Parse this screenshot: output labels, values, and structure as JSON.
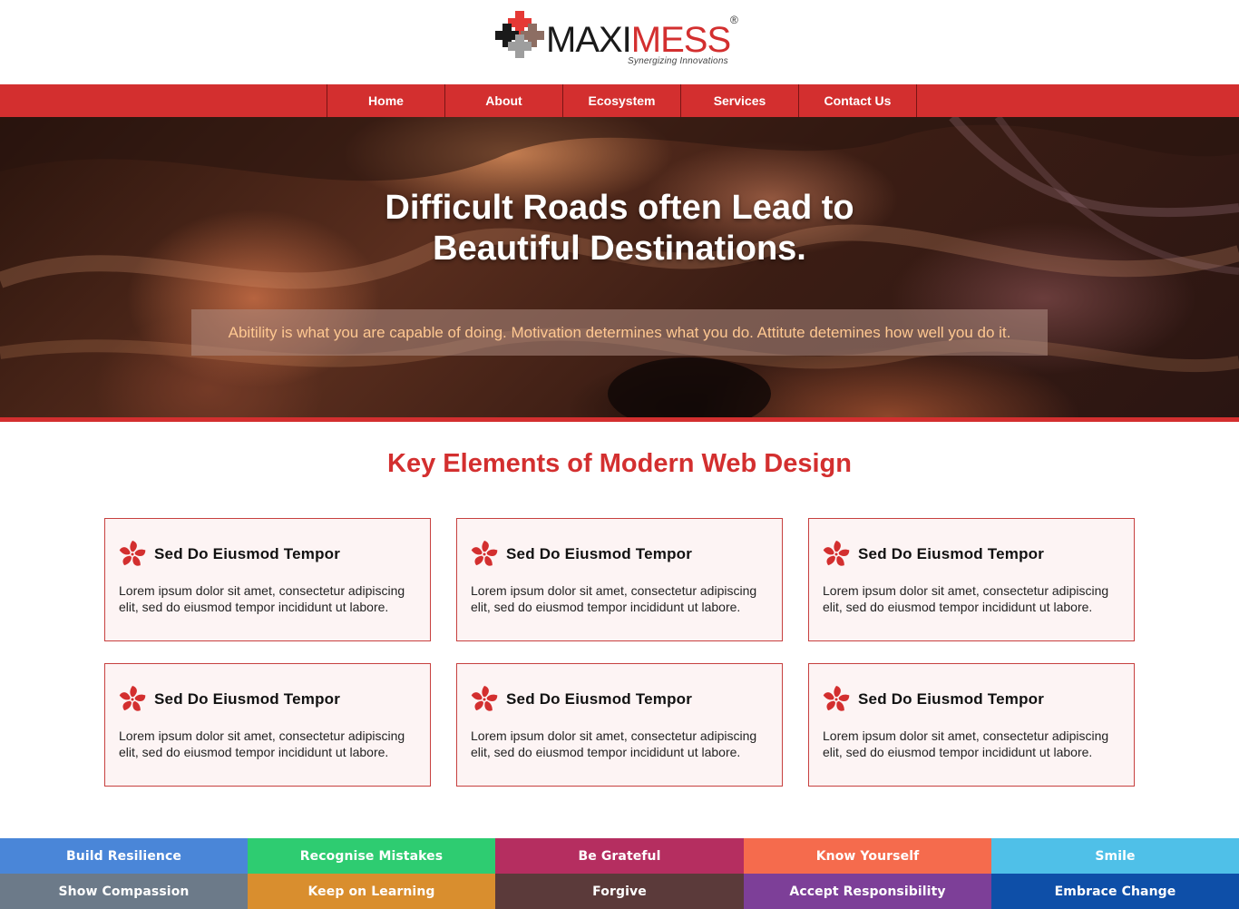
{
  "brand": {
    "name_part1": "MAXI",
    "name_part2": "MESS",
    "registered": "®",
    "tagline": "Synergizing Innovations"
  },
  "nav": {
    "items": [
      "Home",
      "About",
      "Ecosystem",
      "Services",
      "Contact Us"
    ]
  },
  "hero": {
    "title_line1": "Difficult Roads often Lead to",
    "title_line2": "Beautiful Destinations.",
    "quote": "Abitility is what you are capable of doing. Motivation determines what you do. Attitute detemines how well you do it."
  },
  "section": {
    "title": "Key Elements of Modern Web Design",
    "cards": [
      {
        "title": "Sed Do Eiusmod Tempor",
        "text": "Lorem ipsum dolor sit amet, consectetur adipiscing elit, sed do eiusmod tempor incididunt ut labore.",
        "icon": "flower-icon"
      },
      {
        "title": "Sed Do Eiusmod Tempor",
        "text": "Lorem ipsum dolor sit amet, consectetur adipiscing elit, sed do eiusmod tempor incididunt ut labore.",
        "icon": "flower-icon"
      },
      {
        "title": "Sed Do Eiusmod Tempor",
        "text": "Lorem ipsum dolor sit amet, consectetur adipiscing elit, sed do eiusmod tempor incididunt ut labore.",
        "icon": "flower-icon"
      },
      {
        "title": "Sed Do Eiusmod Tempor",
        "text": "Lorem ipsum dolor sit amet, consectetur adipiscing elit, sed do eiusmod tempor incididunt ut labore.",
        "icon": "flower-icon"
      },
      {
        "title": "Sed Do Eiusmod Tempor",
        "text": "Lorem ipsum dolor sit amet, consectetur adipiscing elit, sed do eiusmod tempor incididunt ut labore.",
        "icon": "flower-icon"
      },
      {
        "title": "Sed Do Eiusmod Tempor",
        "text": "Lorem ipsum dolor sit amet, consectetur adipiscing elit, sed do eiusmod tempor incididunt ut labore.",
        "icon": "flower-icon"
      }
    ]
  },
  "pills": [
    {
      "label": "Build Resilience",
      "color": "#4a86d8"
    },
    {
      "label": "Recognise Mistakes",
      "color": "#2ecc71"
    },
    {
      "label": "Be Grateful",
      "color": "#b52e60"
    },
    {
      "label": "Know Yourself",
      "color": "#f56b4d"
    },
    {
      "label": "Smile",
      "color": "#4fc0e8"
    },
    {
      "label": "Show Compassion",
      "color": "#6c7a89"
    },
    {
      "label": "Keep on Learning",
      "color": "#d98e2e"
    },
    {
      "label": "Forgive",
      "color": "#5b3a3a"
    },
    {
      "label": "Accept Responsibility",
      "color": "#7d3f98"
    },
    {
      "label": "Embrace Change",
      "color": "#0e4fa8"
    }
  ],
  "colors": {
    "accent": "#d32f2f",
    "card_bg": "#fdf4f4",
    "quote_text": "#ffc891"
  }
}
